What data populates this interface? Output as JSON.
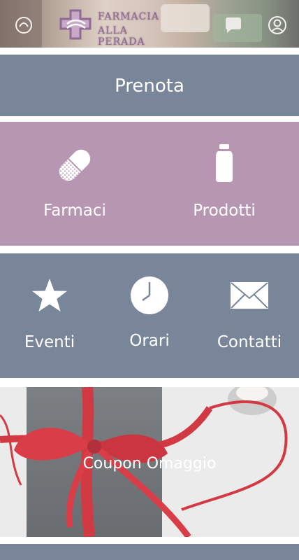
{
  "header": {
    "logo_line1": "FARMACIA",
    "logo_line2": "ALLA PERADA"
  },
  "menu": {
    "prenota": "Prenota",
    "farmaci": "Farmaci",
    "prodotti": "Prodotti",
    "eventi": "Eventi",
    "orari": "Orari",
    "contatti": "Contatti",
    "coupon": "Coupon Omaggio"
  },
  "colors": {
    "slate": "#798599",
    "mauve": "#b796b1"
  }
}
